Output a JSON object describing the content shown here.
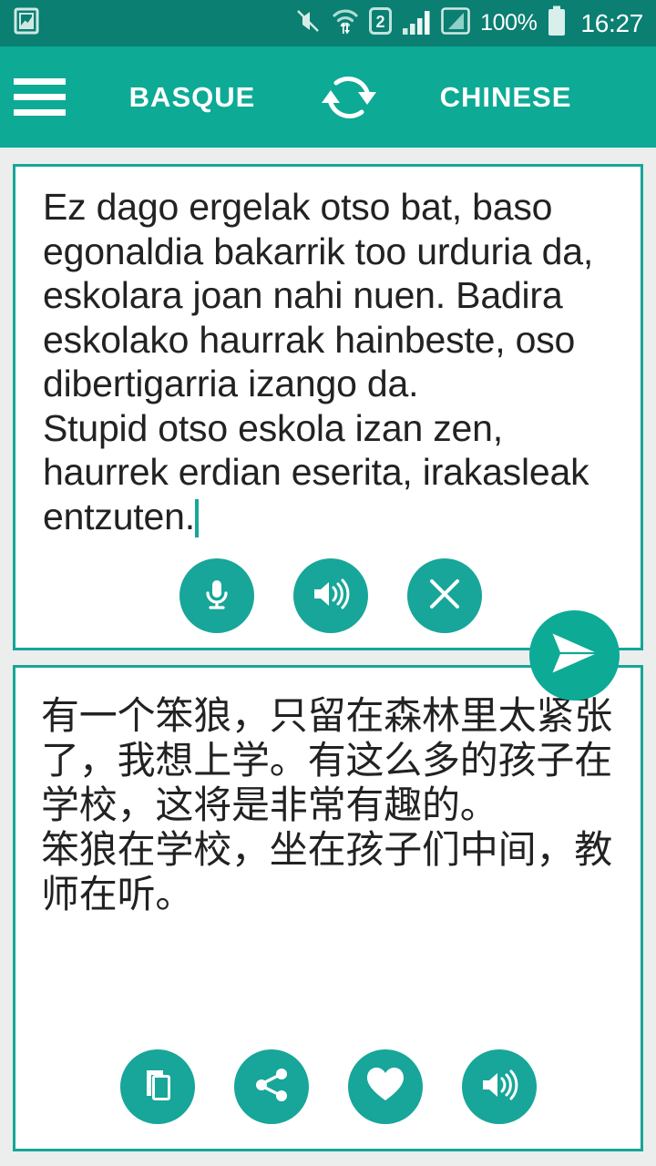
{
  "status_bar": {
    "notification_icon": "image-notification-icon",
    "icons": [
      "mute-icon",
      "wifi-transfer-icon",
      "sim2-icon",
      "signal-bars-icon",
      "mobile-data-icon"
    ],
    "battery_percent": "100%",
    "battery_icon": "battery-full-icon",
    "clock": "16:27",
    "background_color": "#0a7f72",
    "foreground_color": "#ffffff"
  },
  "app_bar": {
    "menu_icon": "hamburger-menu-icon",
    "source_language": "BASQUE",
    "swap_icon": "swap-languages-icon",
    "target_language": "CHINESE",
    "background_color": "#0daa96"
  },
  "source_card": {
    "text": "Ez dago ergelak otso bat, baso egonaldia bakarrik too urduria da, eskolara joan nahi nuen. Badira eskolako haurrak hainbeste, oso dibertigarria izango da.\nStupid otso eskola izan zen, haurrek erdian eserita, irakasleak entzuten.",
    "caret_visible": true,
    "border_color": "#17a699",
    "actions": [
      {
        "name": "microphone-button",
        "icon": "microphone-icon",
        "label": "Voice input"
      },
      {
        "name": "speak-button",
        "icon": "speaker-icon",
        "label": "Speak text"
      },
      {
        "name": "clear-button",
        "icon": "close-icon",
        "label": "Clear text"
      }
    ]
  },
  "send_button": {
    "name": "send-button",
    "icon": "send-paper-plane-icon",
    "label": "Translate",
    "color": "#0daa96"
  },
  "target_card": {
    "text": "有一个笨狼，只留在森林里太紧张了，我想上学。有这么多的孩子在学校，这将是非常有趣的。\n笨狼在学校，坐在孩子们中间，教师在听。",
    "border_color": "#17a699",
    "actions": [
      {
        "name": "copy-button",
        "icon": "copy-icon",
        "label": "Copy"
      },
      {
        "name": "share-button",
        "icon": "share-icon",
        "label": "Share"
      },
      {
        "name": "favorite-button",
        "icon": "heart-icon",
        "label": "Favorite"
      },
      {
        "name": "speak-translation-button",
        "icon": "speaker-icon",
        "label": "Speak translation"
      }
    ]
  },
  "theme": {
    "primary": "#0daa96",
    "primary_dark": "#0a7f72",
    "accent": "#17a699",
    "page_background": "#eceded",
    "card_background": "#ffffff",
    "text_color": "#222222"
  }
}
